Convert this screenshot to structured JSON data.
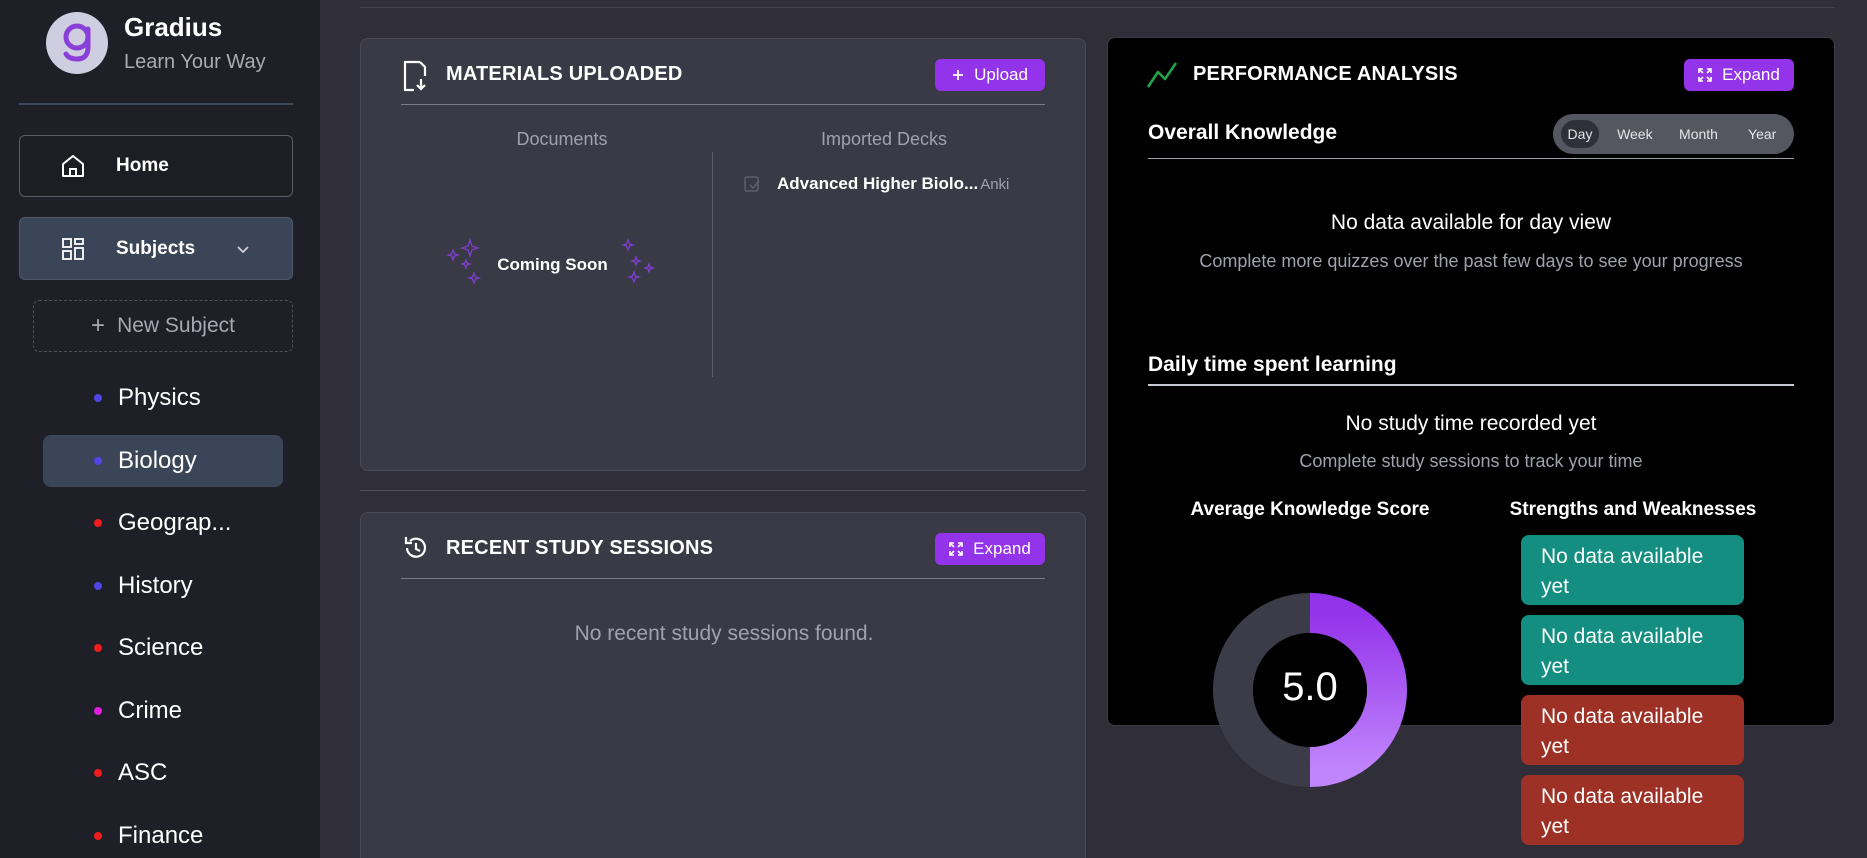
{
  "brand": {
    "title": "Gradius",
    "subtitle": "Learn Your Way",
    "logo_letter": "g"
  },
  "nav": {
    "home_label": "Home",
    "subjects_label": "Subjects",
    "new_subject_label": "New Subject"
  },
  "subjects": [
    {
      "label": "Physics",
      "color": "#4f46e5"
    },
    {
      "label": "Biology",
      "color": "#4f46e5"
    },
    {
      "label": "Geograp...",
      "color": "#ef1c1c"
    },
    {
      "label": "History",
      "color": "#4f46e5"
    },
    {
      "label": "Science",
      "color": "#ef1c1c"
    },
    {
      "label": "Crime",
      "color": "#e11de0"
    },
    {
      "label": "ASC",
      "color": "#ef1c1c"
    },
    {
      "label": "Finance",
      "color": "#ef1c1c"
    }
  ],
  "materials": {
    "title": "MATERIALS UPLOADED",
    "upload_label": "Upload",
    "documents_header": "Documents",
    "decks_header": "Imported Decks",
    "coming_soon": "Coming Soon",
    "decks": [
      {
        "name": "Advanced Higher Biolo...",
        "source": "Anki"
      }
    ]
  },
  "recent": {
    "title": "RECENT STUDY SESSIONS",
    "expand_label": "Expand",
    "empty_text": "No recent study sessions found."
  },
  "performance": {
    "title": "PERFORMANCE ANALYSIS",
    "expand_label": "Expand",
    "overall_heading": "Overall Knowledge",
    "periods": [
      "Day",
      "Week",
      "Month",
      "Year"
    ],
    "selected_period": "Day",
    "no_data_title": "No data available for day view",
    "no_data_sub": "Complete more quizzes over the past few days to see your progress",
    "daily_heading": "Daily time spent learning",
    "no_time_title": "No study time recorded yet",
    "no_time_sub": "Complete study sessions to track your time",
    "avg_heading": "Average Knowledge Score",
    "avg_score": "5.0",
    "avg_fraction": 0.5,
    "sw_heading": "Strengths and Weaknesses",
    "strengths": [
      "No data available yet",
      "No data available yet"
    ],
    "weaknesses": [
      "No data available yet",
      "No data available yet"
    ]
  },
  "colors": {
    "accent": "#9333ea",
    "strength": "#138e80",
    "weakness": "#9e3126",
    "sidebar_bg": "#1f2027",
    "page_bg": "#2f2e39"
  }
}
